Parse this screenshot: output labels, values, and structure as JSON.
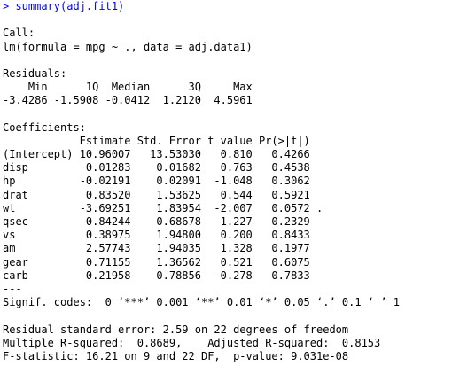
{
  "command": {
    "prompt": "> ",
    "text": "summary(adj.fit1)"
  },
  "call": {
    "header": "Call:",
    "formula": "lm(formula = mpg ~ ., data = adj.data1)"
  },
  "residuals": {
    "header": "Residuals:",
    "labels_line": "    Min      1Q  Median      3Q     Max ",
    "values_line": "-3.4286 -1.5908 -0.0412  1.2120  4.5961 "
  },
  "coefficients": {
    "header": "Coefficients:",
    "column_header": "            Estimate Std. Error t value Pr(>|t|)  ",
    "rows": [
      "(Intercept) 10.96007   13.53030   0.810   0.4266  ",
      "disp         0.01283    0.01682   0.763   0.4538  ",
      "hp          -0.02191    0.02091  -1.048   0.3062  ",
      "drat         0.83520    1.53625   0.544   0.5921  ",
      "wt          -3.69251    1.83954  -2.007   0.0572 .",
      "qsec         0.84244    0.68678   1.227   0.2329  ",
      "vs           0.38975    1.94800   0.200   0.8433  ",
      "am           2.57743    1.94035   1.328   0.1977  ",
      "gear         0.71155    1.36562   0.521   0.6075  ",
      "carb        -0.21958    0.78856  -0.278   0.7833  "
    ],
    "separator": "---",
    "signif_codes": "Signif. codes:  0 ‘***’ 0.001 ‘**’ 0.01 ‘*’ 0.05 ‘.’ 0.1 ‘ ’ 1"
  },
  "summary_stats": {
    "residual_se": "Residual standard error: 2.59 on 22 degrees of freedom",
    "r_squared": "Multiple R-squared:  0.8689,\tAdjusted R-squared:  0.8153 ",
    "f_statistic": "F-statistic: 16.21 on 9 and 22 DF,  p-value: 9.031e-08"
  },
  "colors": {
    "command": "#0000ff",
    "output": "#000000",
    "background": "#ffffff"
  }
}
